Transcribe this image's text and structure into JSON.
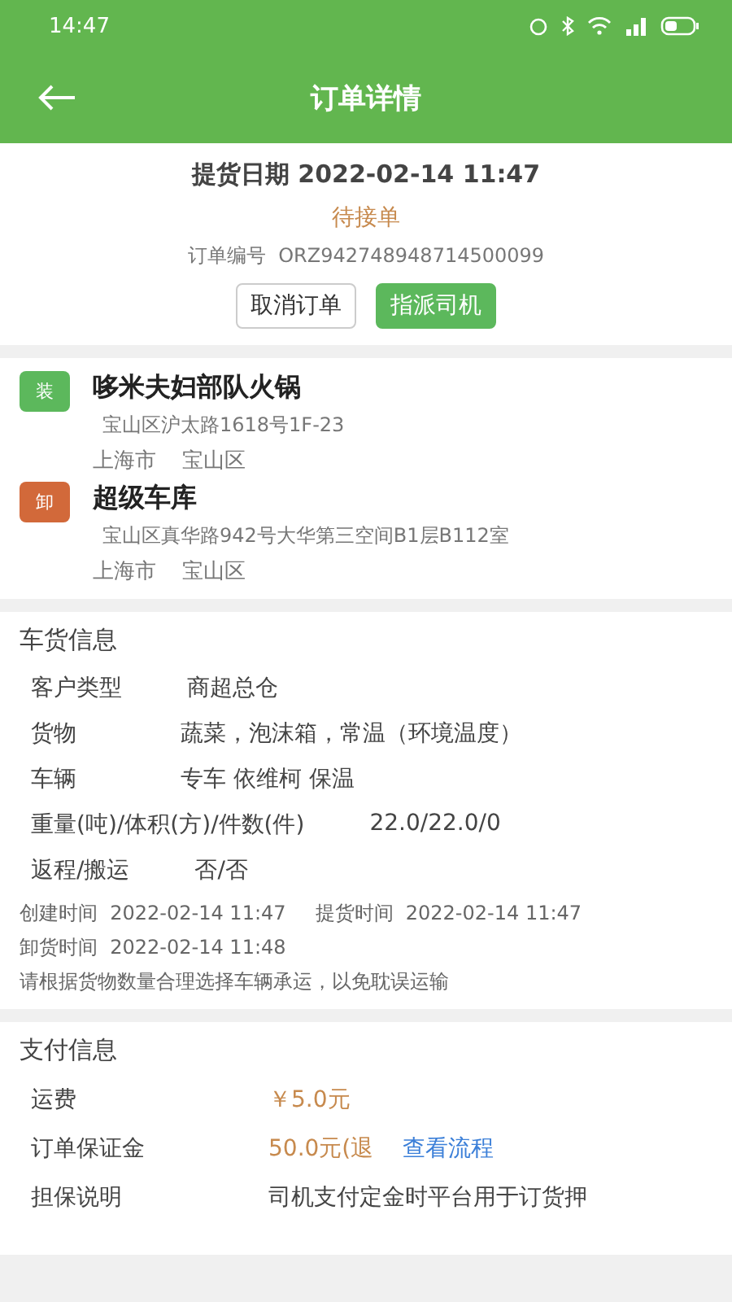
{
  "status_bar": {
    "time": "14:47"
  },
  "header": {
    "title": "订单详情"
  },
  "summary": {
    "pickup_label": "提货日期",
    "pickup_date": "2022-02-14 11:47",
    "status": "待接单",
    "order_no_label": "订单编号",
    "order_no": "ORZ942748948714500099",
    "buttons": [
      {
        "label": "取消订单",
        "kind": "outline"
      },
      {
        "label": "指派司机",
        "kind": "primary"
      }
    ]
  },
  "route": [
    {
      "tag": "装",
      "color": "#5cb85c",
      "name": "哆米夫妇部队火锅",
      "address": "宝山区沪太路1618号1F-23",
      "city": "上海市",
      "district": "宝山区"
    },
    {
      "tag": "卸",
      "color": "#d2693a",
      "name": "超级车库",
      "address": "宝山区真华路942号大华第三空间B1层B112室",
      "city": "上海市",
      "district": "宝山区"
    }
  ],
  "cargo": {
    "title": "车货信息",
    "rows": [
      {
        "label": "客户类型",
        "value": "商超总仓"
      },
      {
        "label": "货物",
        "value": "蔬菜，泡沫箱，常温（环境温度）"
      },
      {
        "label": "车辆",
        "value": "专车  依维柯  保温"
      },
      {
        "label": "重量(吨)/体积(方)/件数(件)",
        "value": "22.0/22.0/0"
      },
      {
        "label": "返程/搬运",
        "value": "否/否"
      }
    ],
    "times": [
      {
        "label": "创建时间",
        "value": "2022-02-14 11:47"
      },
      {
        "label": "提货时间",
        "value": "2022-02-14 11:47"
      },
      {
        "label": "卸货时间",
        "value": "2022-02-14 11:48"
      }
    ],
    "note": "请根据货物数量合理选择车辆承运，以免耽误运输"
  },
  "payment": {
    "title": "支付信息",
    "rows": [
      {
        "label": "运费",
        "value": "￥5.0元"
      },
      {
        "label": "订单保证金",
        "value": "50.0元(退",
        "link": "查看流程"
      },
      {
        "label": "担保说明",
        "value": "司机支付定金时平台用于订货押"
      }
    ]
  }
}
